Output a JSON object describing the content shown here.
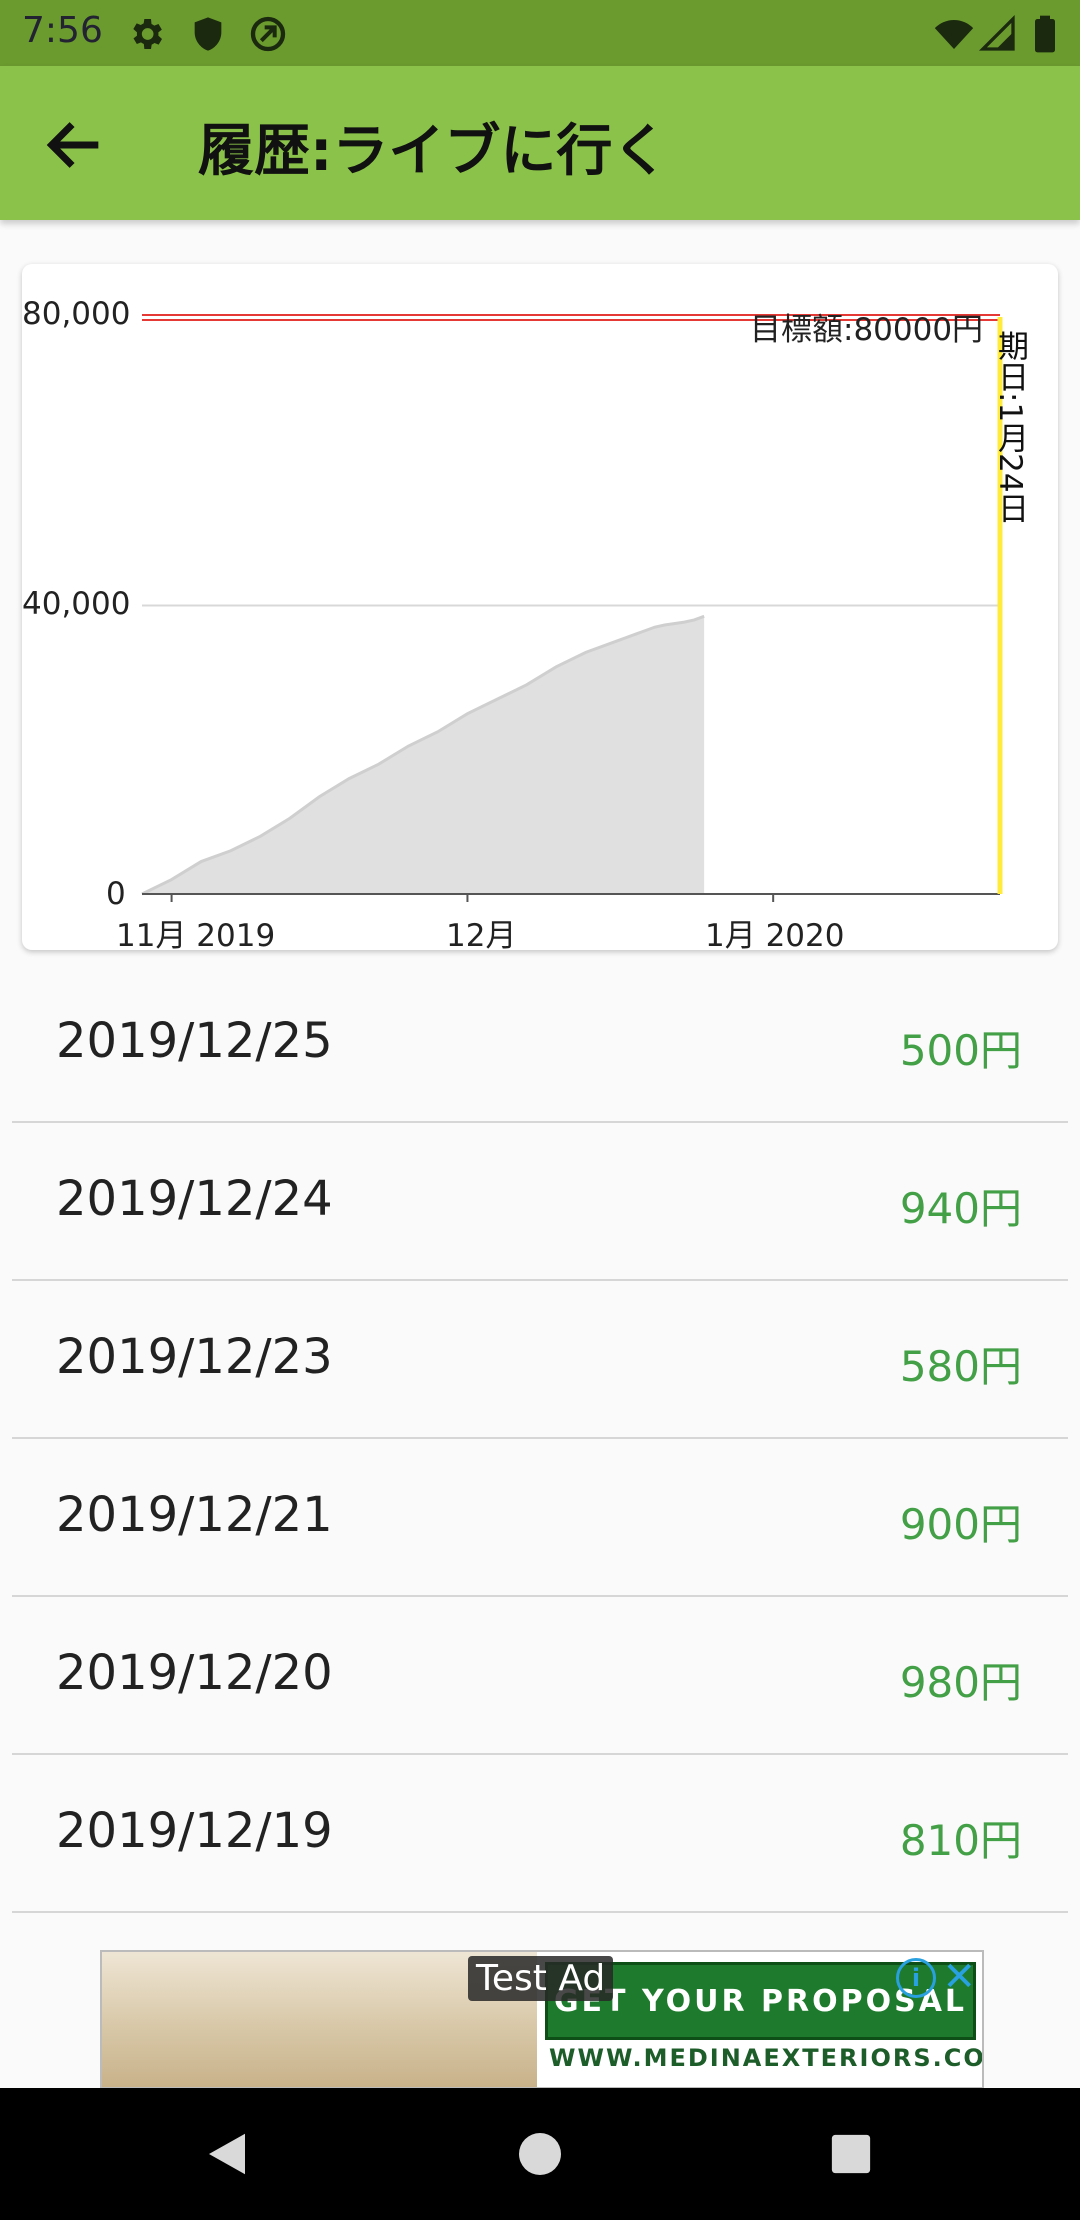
{
  "status_bar": {
    "time": "7:56",
    "left_icons": [
      "gear-icon",
      "shield-icon",
      "sync-icon"
    ],
    "right_icons": [
      "wifi-icon",
      "signal-icon",
      "battery-icon"
    ]
  },
  "app_bar": {
    "title": "履歴:ライブに行く",
    "back_icon": "arrow-left-icon"
  },
  "chart": {
    "annotations": {
      "target": "目標額:80000円",
      "deadline": "期日:1月24日"
    }
  },
  "chart_data": {
    "type": "area",
    "y_ticks": [
      "80,000",
      "40,000",
      "0"
    ],
    "x_ticks": [
      "11月 2019",
      "12月",
      "1月 2020"
    ],
    "ylim": [
      0,
      80000
    ],
    "x_range": [
      "2019-10-29",
      "2020-01-24"
    ],
    "grid": true,
    "target_line": {
      "value": 80000,
      "color": "#e53935"
    },
    "deadline_line": {
      "date": "2020-01-24",
      "color": "#ffeb3b"
    },
    "fill_color": "#e0e0e0",
    "series": [
      {
        "x": [
          "2019-10-29",
          "2019-11-01",
          "2019-11-04",
          "2019-11-07",
          "2019-11-10",
          "2019-11-13",
          "2019-11-16",
          "2019-11-19",
          "2019-11-22",
          "2019-11-25",
          "2019-11-28",
          "2019-12-01",
          "2019-12-04",
          "2019-12-07",
          "2019-12-10",
          "2019-12-13",
          "2019-12-16",
          "2019-12-19",
          "2019-12-20",
          "2019-12-21",
          "2019-12-23",
          "2019-12-24",
          "2019-12-25"
        ],
        "y": [
          0,
          2000,
          4500,
          6000,
          8000,
          10500,
          13500,
          16000,
          18000,
          20500,
          22500,
          25000,
          27000,
          29000,
          31500,
          33500,
          35000,
          36500,
          37000,
          37300,
          37700,
          38000,
          38500
        ]
      }
    ]
  },
  "history": [
    {
      "date": "2019/12/25",
      "amount": "500円"
    },
    {
      "date": "2019/12/24",
      "amount": "940円"
    },
    {
      "date": "2019/12/23",
      "amount": "580円"
    },
    {
      "date": "2019/12/21",
      "amount": "900円"
    },
    {
      "date": "2019/12/20",
      "amount": "980円"
    },
    {
      "date": "2019/12/19",
      "amount": "810円"
    }
  ],
  "ad": {
    "label": "Test Ad",
    "cta": "GET YOUR PROPOSAL",
    "url": "WWW.MEDINAEXTERIORS.COM",
    "info": "i",
    "close": "✕"
  },
  "nav_bar": {
    "icons": [
      "back-icon",
      "home-icon",
      "recents-icon"
    ]
  }
}
